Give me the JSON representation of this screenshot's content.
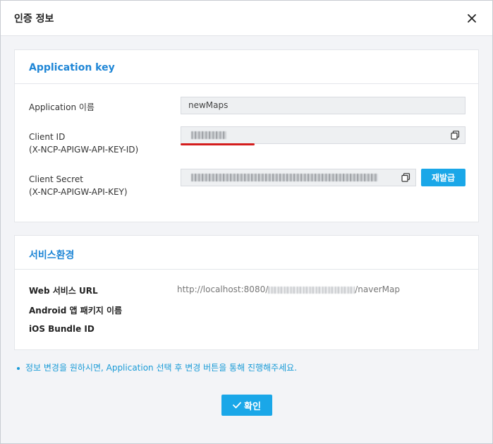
{
  "dialog": {
    "title": "인증 정보",
    "close_icon": "close-icon"
  },
  "app_key": {
    "section_title": "Application key",
    "app_name_label": "Application 이름",
    "app_name_value": "newMaps",
    "client_id_label_1": "Client ID",
    "client_id_label_2": "(X-NCP-APIGW-API-KEY-ID)",
    "client_id_value": "",
    "client_secret_label_1": "Client Secret",
    "client_secret_label_2": "(X-NCP-APIGW-API-KEY)",
    "client_secret_value": "",
    "copy_icon": "copy-icon",
    "reissue_label": "재발급",
    "underline_color": "#d41d1d"
  },
  "service": {
    "section_title": "서비스환경",
    "web_url_label": "Web 서비스 URL",
    "web_url_prefix": "http://localhost:8080/",
    "web_url_suffix": "/naverMap",
    "android_label": "Android 앱 패키지 이름",
    "ios_label": "iOS Bundle ID"
  },
  "note": "정보 변경을 원하시면, Application 선택 후 변경 버튼을 통해 진행해주세요.",
  "footer": {
    "confirm_label": "확인",
    "check_icon": "check-icon"
  },
  "colors": {
    "accent": "#1aa7e8",
    "section_title": "#1f86d6"
  }
}
